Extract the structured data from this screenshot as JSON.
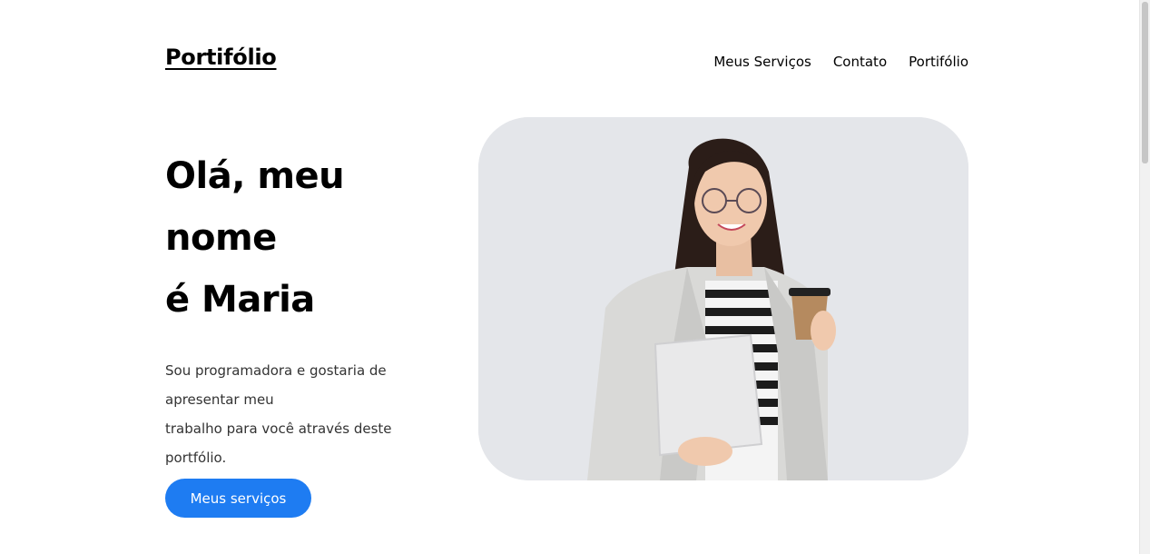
{
  "header": {
    "logo": "Portifólio",
    "nav": [
      "Meus Serviços",
      "Contato",
      "Portifólio"
    ]
  },
  "hero": {
    "headline": [
      "Olá, meu",
      "nome",
      "é Maria"
    ],
    "intro": [
      "Sou programadora e gostaria de",
      "apresentar meu",
      "trabalho para você através deste",
      "portfólio."
    ],
    "cta_label": "Meus serviços"
  },
  "colors": {
    "accent": "#1e7cf2",
    "photo_bg": "#e4e6ea",
    "text": "#000000"
  },
  "icons": {
    "photo": "person-photo"
  }
}
